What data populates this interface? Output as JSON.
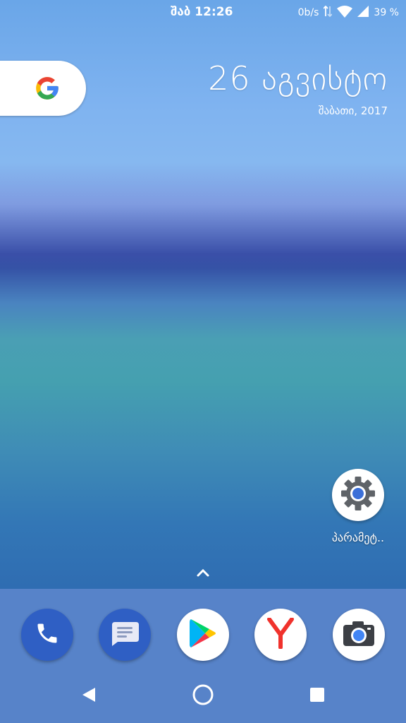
{
  "status_bar": {
    "time": "შაბ 12:26",
    "network_speed": "0b/s",
    "battery": "39 %"
  },
  "widget": {
    "date_main": "26 აგვისტო",
    "date_sub": "შაბათი, 2017"
  },
  "google_search": {
    "icon": "google-g-icon"
  },
  "home_apps": [
    {
      "label": "პარამეტ..",
      "icon": "gear-icon"
    }
  ],
  "dock": [
    {
      "icon": "phone-icon",
      "color": "#2f5fc4"
    },
    {
      "icon": "messages-icon",
      "color": "#2f5fc4"
    },
    {
      "icon": "play-store-icon",
      "color": "#ffffff"
    },
    {
      "icon": "yandex-browser-icon",
      "color": "#ffffff"
    },
    {
      "icon": "camera-icon",
      "color": "#ffffff"
    }
  ],
  "colors": {
    "dock_blue": "#2f5fc4",
    "google_blue": "#4285f4",
    "google_red": "#ea4335",
    "google_yellow": "#fbbc05",
    "google_green": "#34a853"
  }
}
